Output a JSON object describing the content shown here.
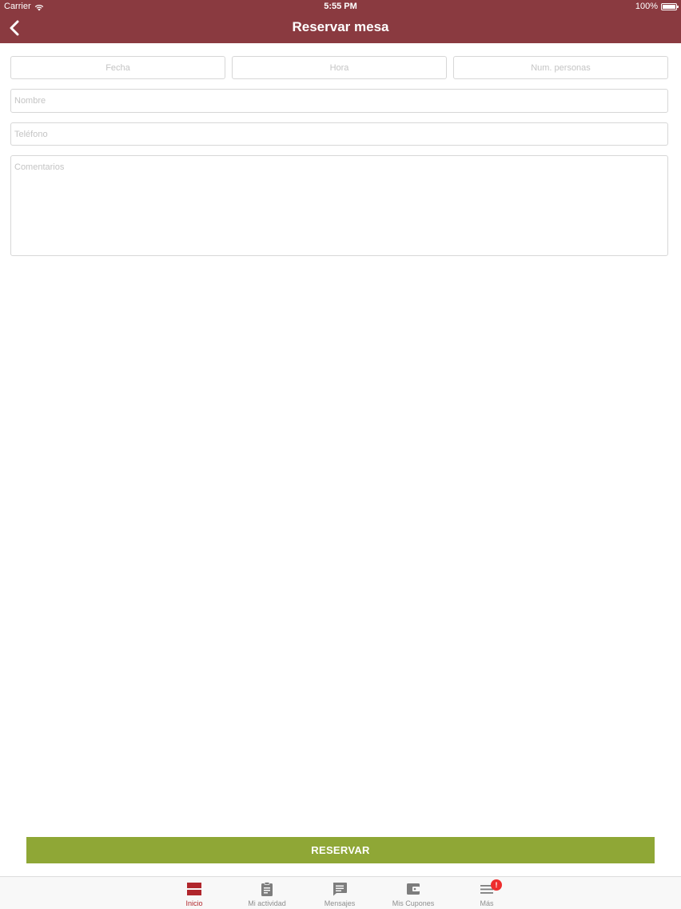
{
  "status_bar": {
    "carrier": "Carrier",
    "time": "5:55 PM",
    "battery": "100%",
    "battery_level": 1.0
  },
  "nav": {
    "title": "Reservar mesa",
    "back_icon": "chevron-left-icon"
  },
  "form": {
    "date_placeholder": "Fecha",
    "time_placeholder": "Hora",
    "people_placeholder": "Num. personas",
    "name_placeholder": "Nombre",
    "phone_placeholder": "Teléfono",
    "comments_placeholder": "Comentarios"
  },
  "reserve_button": "RESERVAR",
  "tab_bar": {
    "items": [
      {
        "label": "Inicio",
        "icon": "home-icon",
        "active": true
      },
      {
        "label": "Mi actividad",
        "icon": "clipboard-icon",
        "active": false
      },
      {
        "label": "Mensajes",
        "icon": "message-icon",
        "active": false
      },
      {
        "label": "Mis Cupones",
        "icon": "wallet-icon",
        "active": false
      },
      {
        "label": "Más",
        "icon": "menu-icon",
        "active": false,
        "badge": "!"
      }
    ]
  },
  "colors": {
    "brand": "#8a3a40",
    "button": "#8fa736",
    "active_tab": "#b0262c",
    "inactive_tab": "#8e8e8e",
    "badge": "#ee2d2d"
  }
}
